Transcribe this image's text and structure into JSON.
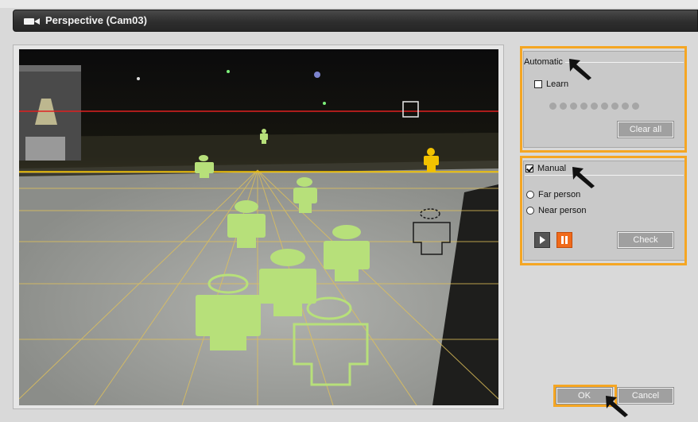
{
  "window": {
    "title": "Perspective (Cam03)",
    "icon": "video-camera-icon"
  },
  "automatic": {
    "label": "Automatic",
    "learn_label": "Learn",
    "learn_checked": false,
    "progress_dots": 9,
    "progress_completed": 0,
    "clear_all_label": "Clear all"
  },
  "manual": {
    "label": "Manual",
    "checked": true,
    "options": [
      {
        "label": "Far person",
        "selected": false
      },
      {
        "label": "Near person",
        "selected": false
      }
    ],
    "play_icon": "play-icon",
    "pause_icon": "pause-icon",
    "check_label": "Check"
  },
  "footer": {
    "ok_label": "OK",
    "cancel_label": "Cancel"
  },
  "colors": {
    "highlight": "#f5a623",
    "horizon_line": "#e02020",
    "far_line": "#f2c200",
    "person_figure": "#b7e07a",
    "pause_button": "#f06a1a"
  }
}
